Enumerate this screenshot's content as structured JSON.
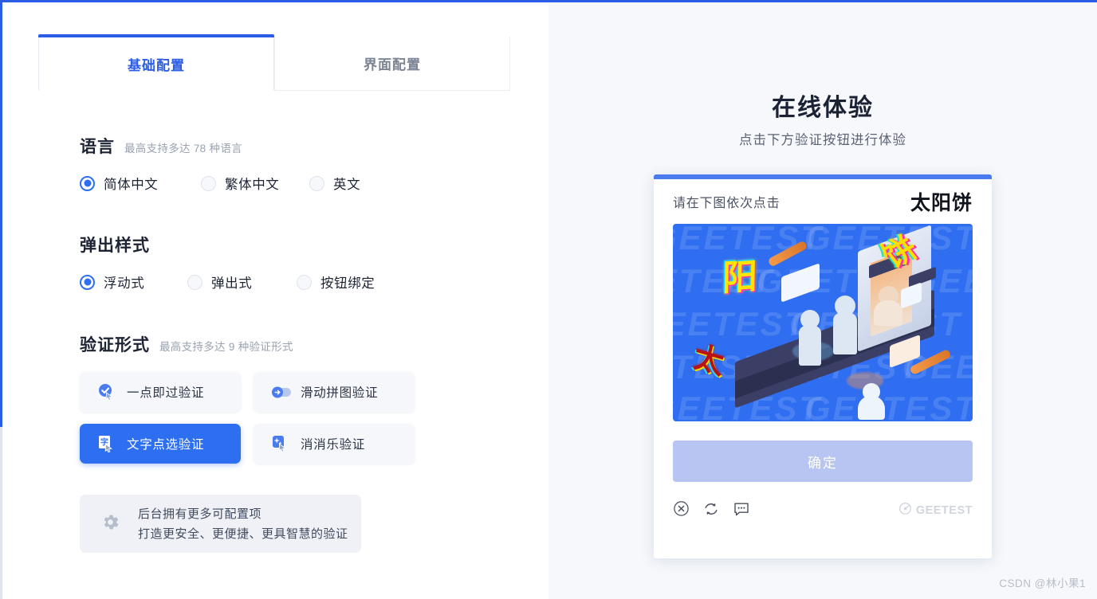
{
  "frame": {
    "accent_color": "#2b5ce6",
    "left_bg": "#ffffff",
    "right_bg": "#f6f8fc"
  },
  "tabs": [
    {
      "label": "基础配置",
      "active": true
    },
    {
      "label": "界面配置",
      "active": false
    }
  ],
  "sections": {
    "language": {
      "title": "语言",
      "subtitle": "最高支持多达 78 种语言",
      "options": [
        {
          "label": "简体中文",
          "selected": true
        },
        {
          "label": "繁体中文",
          "selected": false
        },
        {
          "label": "英文",
          "selected": false
        }
      ]
    },
    "popup_style": {
      "title": "弹出样式",
      "subtitle": "",
      "options": [
        {
          "label": "浮动式",
          "selected": true
        },
        {
          "label": "弹出式",
          "selected": false
        },
        {
          "label": "按钮绑定",
          "selected": false
        }
      ]
    },
    "verify_form": {
      "title": "验证形式",
      "subtitle": "最高支持多达 9 种验证形式",
      "options": [
        {
          "label": "一点即过验证",
          "icon": "check-circle-cursor-icon",
          "selected": false
        },
        {
          "label": "滑动拼图验证",
          "icon": "slider-arrow-icon",
          "selected": false
        },
        {
          "label": "文字点选验证",
          "icon": "text-click-icon",
          "selected": true
        },
        {
          "label": "消消乐验证",
          "icon": "sparkle-click-icon",
          "selected": false
        }
      ]
    },
    "note": {
      "icon": "gear-icon",
      "line1": "后台拥有更多可配置项",
      "line2": "打造更安全、更便捷、更具智慧的验证"
    }
  },
  "demo": {
    "title": "在线体验",
    "subtitle": "点击下方验证按钮进行体验",
    "captcha": {
      "hint": "请在下图依次点击",
      "target_word": "太阳饼",
      "image": {
        "background_color": "#2f6ef0",
        "watermark_text": "GEETEST",
        "target_chars": [
          "阳",
          "太",
          "饼"
        ]
      },
      "confirm_label": "确定",
      "footer_icons": [
        {
          "name": "close-icon",
          "label": "关闭"
        },
        {
          "name": "refresh-icon",
          "label": "刷新"
        },
        {
          "name": "feedback-icon",
          "label": "反馈"
        }
      ],
      "brand": "GEETEST",
      "brand_icon": "geetest-logo-icon"
    }
  },
  "watermark": "CSDN @林小果1"
}
